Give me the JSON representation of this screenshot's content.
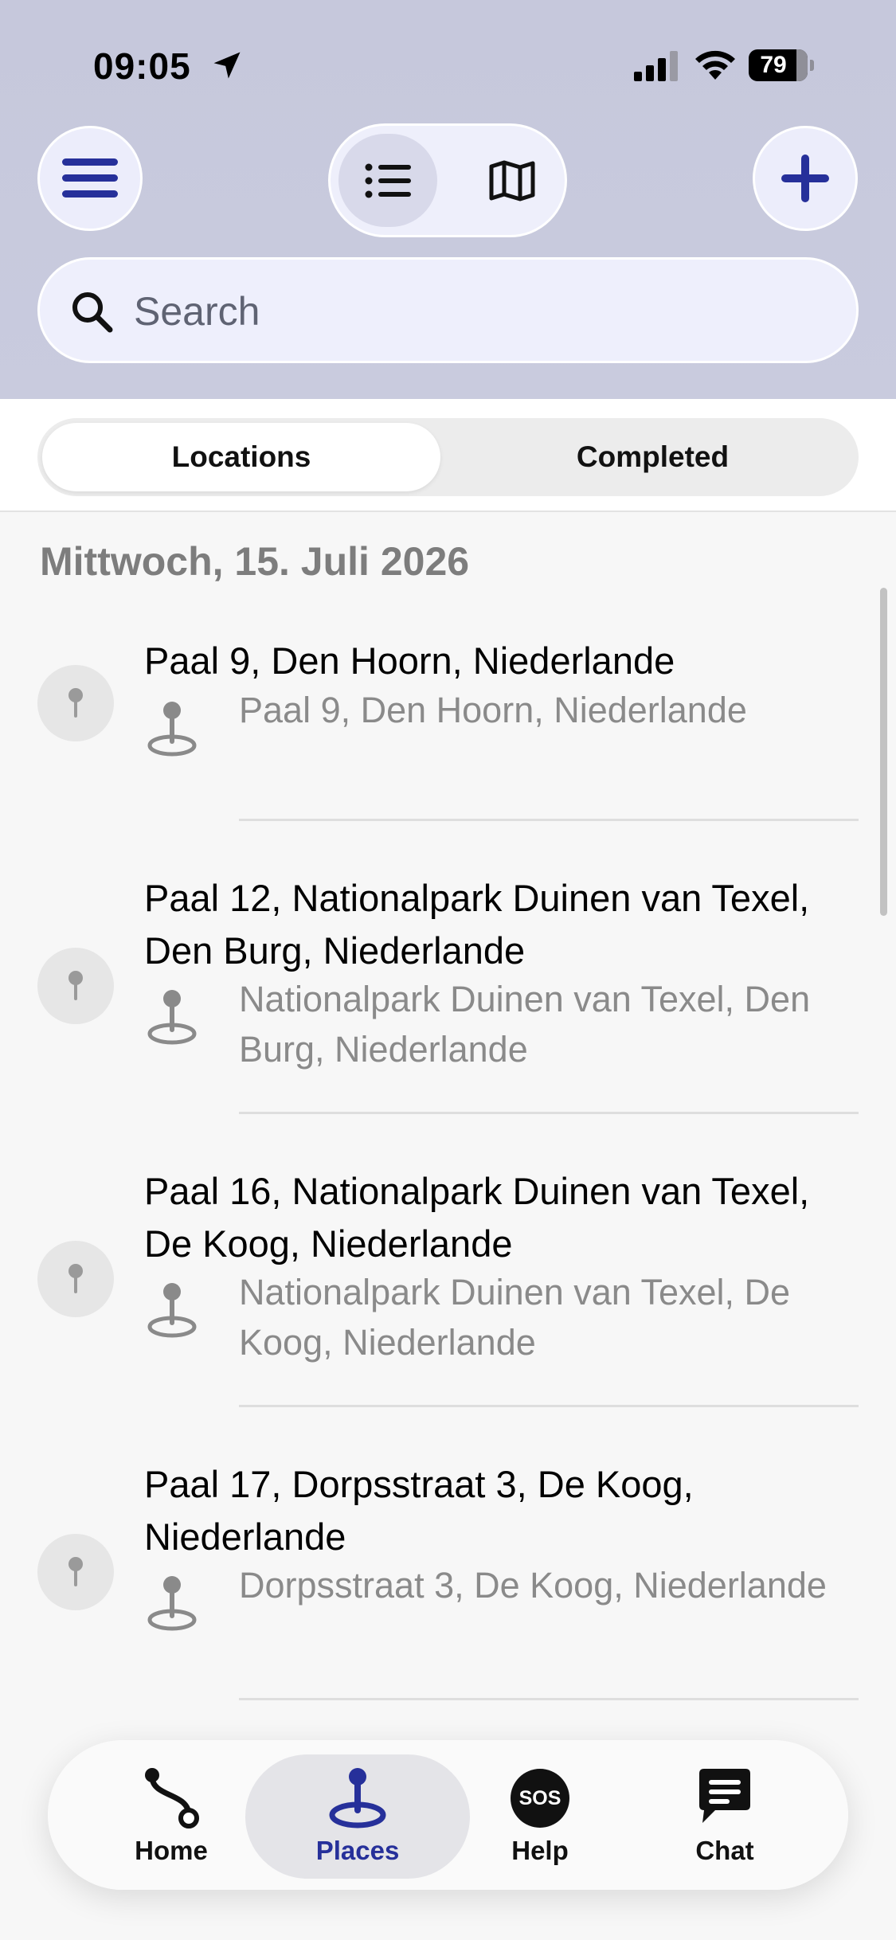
{
  "status_bar": {
    "time": "09:05",
    "battery": "79"
  },
  "header": {
    "menu_icon": "hamburger-icon",
    "add_icon": "plus-icon",
    "view_toggle": {
      "list_icon": "list-icon",
      "map_icon": "map-icon",
      "selected": "list"
    },
    "search": {
      "placeholder": "Search",
      "value": ""
    }
  },
  "segments": {
    "locations": "Locations",
    "completed": "Completed",
    "selected": "locations"
  },
  "list": {
    "date_header": "Mittwoch, 15. Juli 2026",
    "items": [
      {
        "title": "Paal 9, Den Hoorn, Niederlande",
        "subtitle": "Paal 9, Den Hoorn, Niederlande"
      },
      {
        "title": "Paal 12, Nationalpark Duinen van Texel, Den Burg, Niederlande",
        "subtitle": "Nationalpark Duinen van Texel, Den Burg, Niederlande"
      },
      {
        "title": "Paal 16, Nationalpark Duinen van Texel, De Koog, Niederlande",
        "subtitle": "Nationalpark Duinen van Texel, De Koog, Niederlande"
      },
      {
        "title": "Paal 17, Dorpsstraat 3, De Koog, Niederlande",
        "subtitle": "Dorpsstraat 3, De Koog, Niederlande"
      }
    ]
  },
  "tabbar": {
    "home": "Home",
    "places": "Places",
    "help": "Help",
    "help_badge": "SOS",
    "chat": "Chat",
    "selected": "places"
  },
  "colors": {
    "accent": "#26309a",
    "header_bg": "#c8cadd",
    "secondary_text": "#8a8a8a"
  }
}
